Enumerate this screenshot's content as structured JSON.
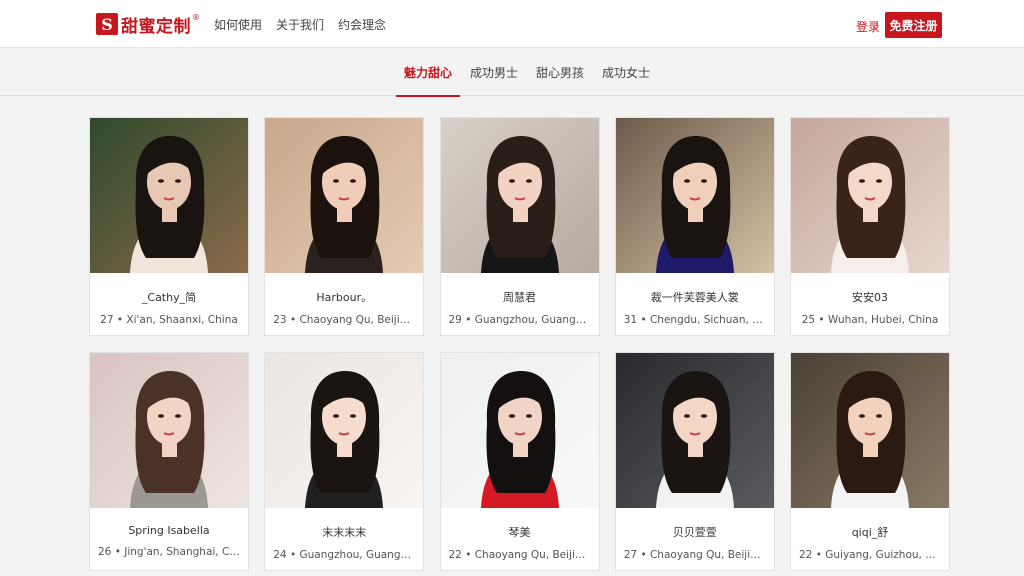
{
  "brand": {
    "mark": "S",
    "name": "甜蜜定制",
    "reg": "®"
  },
  "nav": {
    "items": [
      "如何使用",
      "关于我们",
      "约会理念"
    ]
  },
  "auth": {
    "login": "登录",
    "register": "免费注册"
  },
  "tabs": {
    "items": [
      "魅力甜心",
      "成功男士",
      "甜心男孩",
      "成功女士"
    ],
    "active_index": 0
  },
  "profiles": [
    {
      "name": "_Cathy_简",
      "meta": "27 • Xi'an, Shaanxi, China",
      "photo": {
        "bg": "#2f4a2c",
        "bg2": "#8a6a4a",
        "hair": "#1a1410",
        "skin": "#e8c8b4",
        "cloth": "#f0e6dc"
      }
    },
    {
      "name": "Harbour。",
      "meta": "23 • Chaoyang Qu, Beijin...",
      "photo": {
        "bg": "#c9a88c",
        "bg2": "#e4cbb4",
        "hair": "#1b120e",
        "skin": "#efcdb8",
        "cloth": "#2b2220"
      }
    },
    {
      "name": "周慧君",
      "meta": "29 • Guangzhou, Guangd...",
      "photo": {
        "bg": "#d8d0c8",
        "bg2": "#b8aaa0",
        "hair": "#2a1e18",
        "skin": "#f2d2c0",
        "cloth": "#151515"
      }
    },
    {
      "name": "裁一件芙蓉美人裳",
      "meta": "31 • Chengdu, Sichuan, C...",
      "photo": {
        "bg": "#6f5a4a",
        "bg2": "#d4c2a4",
        "hair": "#1a1410",
        "skin": "#f0d0bc",
        "cloth": "#1d1a6a"
      }
    },
    {
      "name": "安安03",
      "meta": "25 • Wuhan, Hubei, China",
      "photo": {
        "bg": "#c4a89a",
        "bg2": "#e8d6cc",
        "hair": "#3a2418",
        "skin": "#f4d8c8",
        "cloth": "#f6eeea"
      }
    },
    {
      "name": "Spring Isabella",
      "meta": "26 • Jing'an, Shanghai, Ch...",
      "photo": {
        "bg": "#d8c4c0",
        "bg2": "#f0e4e0",
        "hair": "#4a3226",
        "skin": "#f2d4c4",
        "cloth": "#9a9890"
      }
    },
    {
      "name": "末末末末",
      "meta": "24 • Guangzhou, Guangd...",
      "photo": {
        "bg": "#ece6e2",
        "bg2": "#f8f4f2",
        "hair": "#1a1412",
        "skin": "#f6dccd",
        "cloth": "#202020"
      }
    },
    {
      "name": "琴美",
      "meta": "22 • Chaoyang Qu, Beijin...",
      "photo": {
        "bg": "#efefef",
        "bg2": "#f8f8f8",
        "hair": "#141010",
        "skin": "#f0d4c6",
        "cloth": "#d41a22"
      }
    },
    {
      "name": "贝贝萱萱",
      "meta": "27 • Chaoyang Qu, Beijin...",
      "photo": {
        "bg": "#2a2a2e",
        "bg2": "#5a5a60",
        "hair": "#1a1412",
        "skin": "#f4d6c6",
        "cloth": "#f2f2f2"
      }
    },
    {
      "name": "qiqi_舒",
      "meta": "22 • Guiyang, Guizhou, C...",
      "photo": {
        "bg": "#4a4036",
        "bg2": "#8a7a64",
        "hair": "#2a1a12",
        "skin": "#f2d2bc",
        "cloth": "#f4f4f4"
      }
    }
  ],
  "colors": {
    "accent": "#c8161d",
    "page_bg": "#f3f3f3"
  }
}
